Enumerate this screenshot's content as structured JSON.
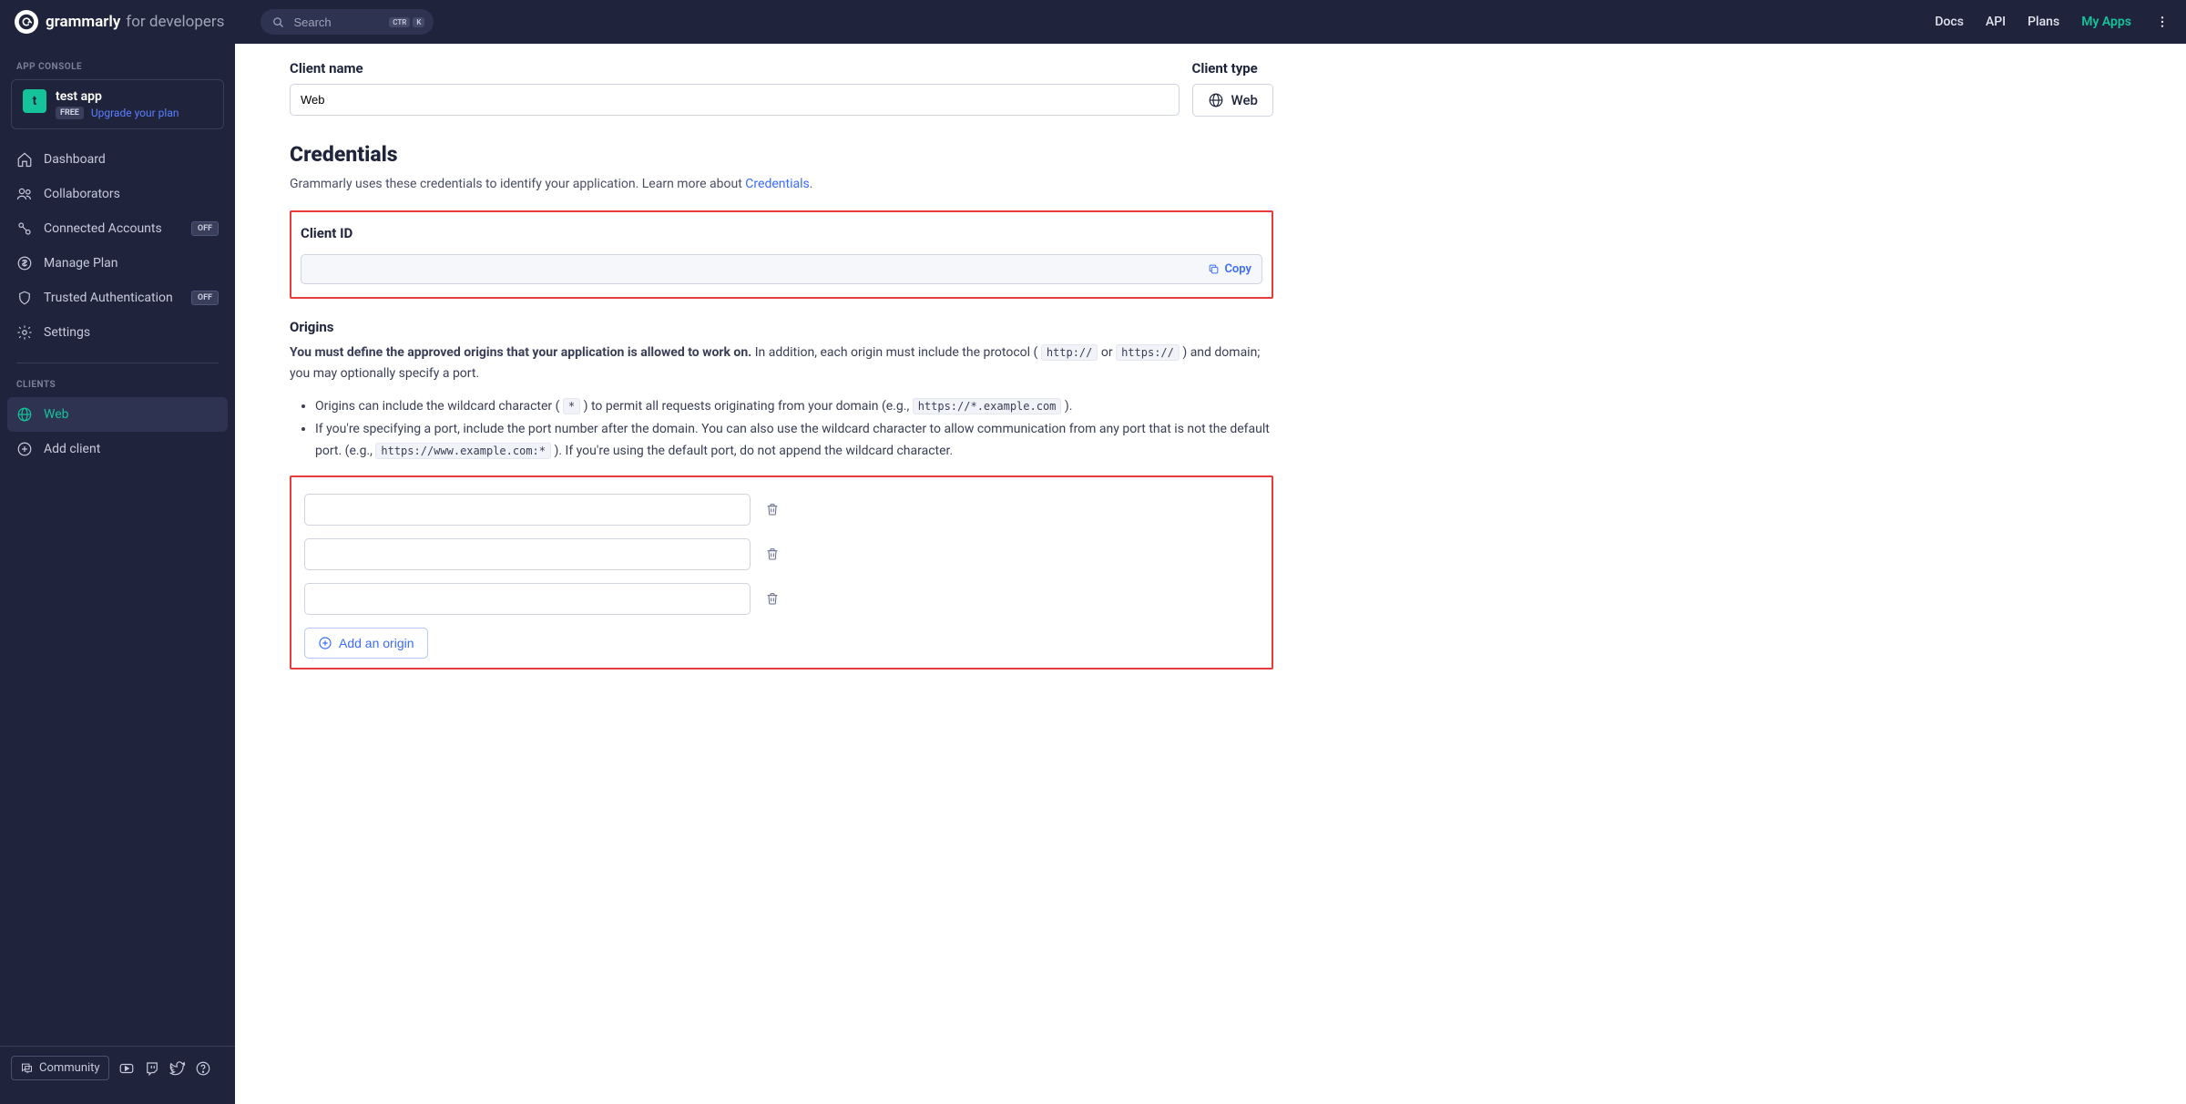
{
  "brand": {
    "name": "grammarly",
    "suffix": "for developers"
  },
  "search": {
    "placeholder": "Search",
    "kbd1": "CTR",
    "kbd2": "K"
  },
  "topnav": {
    "docs": "Docs",
    "api": "API",
    "plans": "Plans",
    "myapps": "My Apps"
  },
  "sidebar": {
    "heading1": "APP CONSOLE",
    "app": {
      "initial": "t",
      "name": "test app",
      "plan": "FREE",
      "upgrade": "Upgrade your plan"
    },
    "items": [
      {
        "label": "Dashboard"
      },
      {
        "label": "Collaborators"
      },
      {
        "label": "Connected Accounts",
        "badge": "OFF"
      },
      {
        "label": "Manage Plan"
      },
      {
        "label": "Trusted Authentication",
        "badge": "OFF"
      },
      {
        "label": "Settings"
      }
    ],
    "heading2": "CLIENTS",
    "client": "Web",
    "addClient": "Add client",
    "community": "Community"
  },
  "main": {
    "clientNameLabel": "Client name",
    "clientNameValue": "Web",
    "clientTypeLabel": "Client type",
    "clientTypeValue": "Web",
    "credentials": {
      "heading": "Credentials",
      "desc_pre": "Grammarly uses these credentials to identify your application. Learn more about ",
      "desc_link": "Credentials",
      "desc_post": ".",
      "clientIdLabel": "Client ID",
      "copy": "Copy"
    },
    "origins": {
      "heading": "Origins",
      "bold": "You must define the approved origins that your application is allowed to work on.",
      "p1a": " In addition, each origin must include the protocol ( ",
      "c1": "http://",
      "p1b": " or ",
      "c2": "https://",
      "p1c": " ) and domain; you may optionally specify a port.",
      "li1_a": "Origins can include the wildcard character ( ",
      "li1_code": "*",
      "li1_b": " ) to permit all requests originating from your domain (e.g., ",
      "li1_code2": "https://*.example.com",
      "li1_c": " ).",
      "li2_a": "If you're specifying a port, include the port number after the domain. You can also use the wildcard character to allow communication from any port that is not the default port. (e.g., ",
      "li2_code": "https://www.example.com:*",
      "li2_b": " ). If you're using the default port, do not append the wildcard character.",
      "addOrigin": "Add an origin"
    }
  }
}
